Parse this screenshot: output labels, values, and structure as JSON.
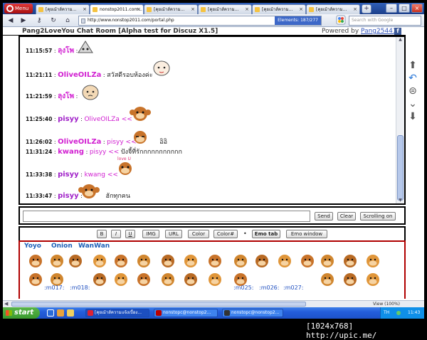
{
  "browser": {
    "menu_label": "Menu",
    "tabs": [
      {
        "label": "[คุยเม้าส์ความ...",
        "active": false
      },
      {
        "label": "nonstop2011.com...",
        "active": true
      },
      {
        "label": "[คุยเม้าส์ความ...",
        "active": false
      },
      {
        "label": "[คุยเม้าส์ความ...",
        "active": false
      },
      {
        "label": "[คุยเม้าส์ความ...",
        "active": false
      },
      {
        "label": "[คุยเม้าส์ความ...",
        "active": false
      }
    ],
    "url": "http://www.nonstop2011.com/portal.php",
    "elements_badge": "Elements: 187/277",
    "search_placeholder": "Search with Google"
  },
  "chat": {
    "title": "Pang2LoveYou Chat Room [Alpha test for Discuz X1.5]",
    "powered_prefix": "Powered by",
    "powered_link": "Pang25441",
    "messages": [
      {
        "time": "11:15:57",
        "nick": "ลุงโพ",
        "text": "",
        "nick_color": "#d11fd1"
      },
      {
        "time": "11:21:11",
        "nick": "OliveOILZa",
        "text": "สวัสดีรอบห้องค่ะ",
        "nick_color": "#d11fd1"
      },
      {
        "time": "11:21:59",
        "nick": "ลุงโพ",
        "text": "",
        "nick_color": "#d11fd1"
      },
      {
        "time": "11:25:40",
        "nick": "pisyy",
        "text": "OliveOILZa <<",
        "nick_color": "#a020c8"
      },
      {
        "time": "11:26:02",
        "nick": "OliveOILZa",
        "text": "pisyy <<",
        "nick_color": "#d11fd1"
      },
      {
        "time": "11:31:24",
        "nick": "kwang",
        "text": "pisyy <<",
        "nick_color": "#d11fd1"
      },
      {
        "time": "11:33:38",
        "nick": "pisyy",
        "text": "kwang <<",
        "nick_color": "#a020c8"
      },
      {
        "time": "11:33:47",
        "nick": "pisyy",
        "text": "",
        "nick_color": "#a020c8"
      }
    ],
    "extra_texts": {
      "msg5_tail": "อิอิ",
      "msg6_tail": "ปังจี้ที่รักกกกกกกกกกก",
      "msg8_tail": "ฮักทุกคน"
    },
    "buttons": {
      "send": "Send",
      "clear": "Clear",
      "scroll": "Scrolling on"
    },
    "format_buttons": [
      "B",
      "I",
      "U",
      "IMG",
      "URL",
      "Color",
      "Color#"
    ],
    "emo_tab_button": "Emo tab",
    "emo_window_button": "Emo window",
    "emo_tabs": [
      "Yoyo",
      "Onion",
      "WanWan"
    ],
    "emo_codes": [
      ":m017:",
      ":m018:",
      ":m025:",
      ":m026:",
      ":m027:"
    ]
  },
  "statusbar": {
    "view": "View (100%)"
  },
  "taskbar": {
    "start_label": "start",
    "tasks": [
      {
        "label": "[คุยเม้าส์ความแจ้งเบื้อง..."
      },
      {
        "label": "nonstopc@nonstop2..."
      },
      {
        "label": "nonstopc@nonstop2..."
      }
    ],
    "lang": "TH",
    "clock": "11:43"
  },
  "credit": "[1024x768] http://upic.me/"
}
